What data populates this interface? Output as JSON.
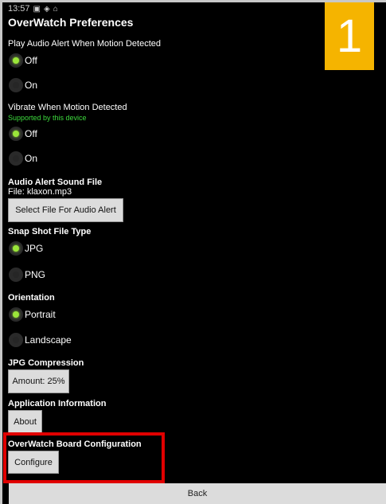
{
  "status": {
    "time": "13:57"
  },
  "header": {
    "title": "OverWatch Preferences"
  },
  "badge": "1",
  "audio_alert": {
    "label": "Play Audio Alert When Motion Detected",
    "options": [
      {
        "label": "Off",
        "selected": true
      },
      {
        "label": "On",
        "selected": false
      }
    ]
  },
  "vibrate": {
    "label": "Vibrate When Motion Detected",
    "support": "Supported by this device",
    "options": [
      {
        "label": "Off",
        "selected": true
      },
      {
        "label": "On",
        "selected": false
      }
    ]
  },
  "sound_file": {
    "label": "Audio Alert Sound File",
    "file": "File: klaxon.mp3",
    "button": "Select File For Audio Alert"
  },
  "snapshot": {
    "label": "Snap Shot File Type",
    "options": [
      {
        "label": "JPG",
        "selected": true
      },
      {
        "label": "PNG",
        "selected": false
      }
    ]
  },
  "orientation": {
    "label": "Orientation",
    "options": [
      {
        "label": "Portrait",
        "selected": true
      },
      {
        "label": "Landscape",
        "selected": false
      }
    ]
  },
  "compression": {
    "label": "JPG Compression",
    "button": "Amount: 25%"
  },
  "app_info": {
    "label": "Application Information",
    "button": "About"
  },
  "board": {
    "label": "OverWatch Board Configuration",
    "button": "Configure"
  },
  "footer": {
    "back": "Back"
  },
  "colors": {
    "accent": "#9be63a",
    "badge": "#f5b400",
    "highlight": "#e10000",
    "support_text": "#3ddc3d"
  }
}
